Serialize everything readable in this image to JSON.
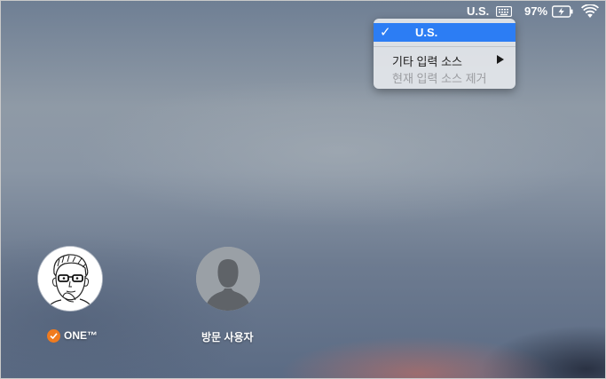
{
  "menubar": {
    "input_source": "U.S.",
    "battery_percent": "97%",
    "icons": [
      "keyboard-icon",
      "battery-charging-icon",
      "wifi-icon"
    ]
  },
  "input_menu": {
    "selected_item": "U.S.",
    "items": [
      {
        "label": "기타 입력 소스",
        "enabled": true,
        "has_submenu": true
      },
      {
        "label": "현재 입력 소스 제거",
        "enabled": false,
        "has_submenu": false
      }
    ]
  },
  "users": [
    {
      "name": "ONE™",
      "logged_in": true,
      "avatar": "cartoon-portrait"
    },
    {
      "name": "방문 사용자",
      "logged_in": false,
      "avatar": "generic-silhouette"
    }
  ],
  "colors": {
    "highlight": "#2c7df4",
    "logged_in_badge": "#f07b1f"
  }
}
